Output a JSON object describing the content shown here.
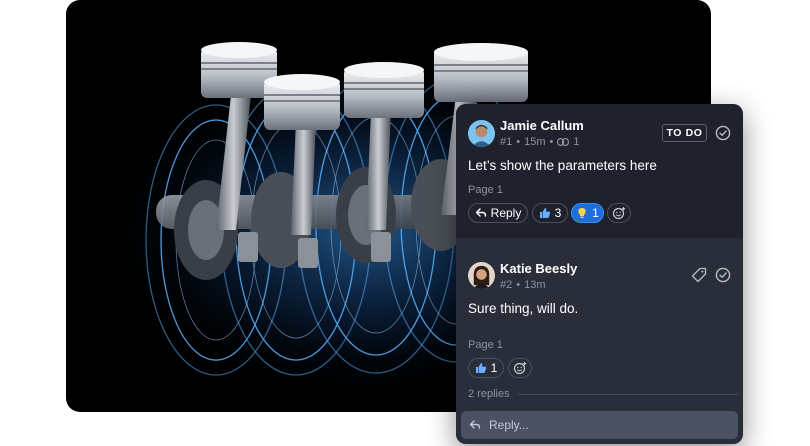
{
  "thread_1": {
    "author": "Jamie Callum",
    "meta_id": "#1",
    "meta_time": "15m",
    "meta_link_count": "1",
    "status_badge": "TO DO",
    "body": "Let’s show the parameters here",
    "page_ref": "Page 1",
    "reply_label": "Reply",
    "reactions": [
      {
        "icon": "thumbs-up-icon",
        "count": "3",
        "active": false
      },
      {
        "icon": "lightbulb-icon",
        "count": "1",
        "active": true
      }
    ]
  },
  "thread_2": {
    "author": "Katie Beesly",
    "meta_id": "#2",
    "meta_time": "13m",
    "body": "Sure thing, will do.",
    "page_ref": "Page 1",
    "reactions": [
      {
        "icon": "thumbs-up-icon",
        "count": "1",
        "active": false
      }
    ],
    "replies_label": "2 replies",
    "reply_placeholder": "Reply..."
  },
  "colors": {
    "panel_bg": "#2a2e3a",
    "active_thread_bg": "#1f222c",
    "accent": "#1e6fd8",
    "glow": "#4aa8ff"
  }
}
